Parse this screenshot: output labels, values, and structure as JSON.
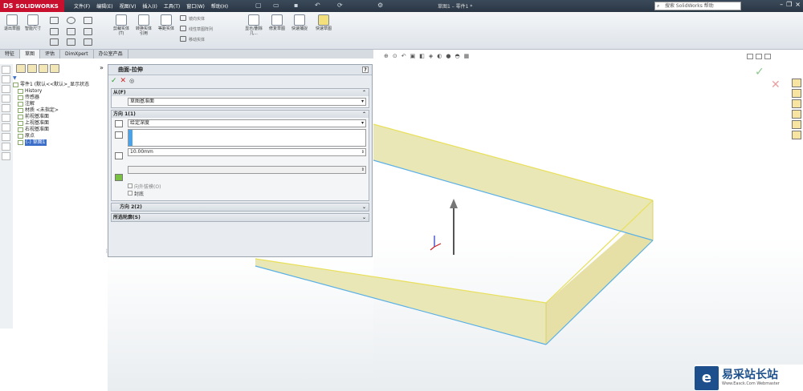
{
  "app": {
    "brand_prefix": "DS",
    "brand": "SOLIDWORKS",
    "window_title": "草图1 – 零件1 *"
  },
  "menu": [
    "文件(F)",
    "编辑(E)",
    "视图(V)",
    "插入(I)",
    "工具(T)",
    "窗口(W)",
    "帮助(H)"
  ],
  "search": {
    "placeholder": "搜索 SolidWorks 帮助"
  },
  "commands": [
    {
      "label": "退出草图"
    },
    {
      "label": "智能尺寸"
    },
    {
      "label": "剪裁实体(T)"
    },
    {
      "label": "转换实体引用"
    },
    {
      "label": "等距实体"
    },
    {
      "label": "显示/删除几..."
    },
    {
      "label": "修复草图"
    },
    {
      "label": "快速捕捉"
    },
    {
      "label": "快速草图"
    }
  ],
  "sketch_tools": [
    "镜向实体",
    "线性草图阵列",
    "移动实体"
  ],
  "tabs": [
    "特征",
    "草图",
    "评估",
    "DimXpert",
    "办公室产品"
  ],
  "tree": {
    "root": "零件1 (默认<<默认>_显示状态",
    "items": [
      "History",
      "传感器",
      "注解",
      "材质 <未指定>",
      "前视基准面",
      "上视基准面",
      "右视基准面",
      "原点",
      "(-) 草图1"
    ]
  },
  "property": {
    "title": "曲面-拉伸",
    "help": "?",
    "from_label": "从(F)",
    "from_value": "草图基准面",
    "dir1_label": "方向 1(1)",
    "end_condition": "给定深度",
    "depth": "10.00mm",
    "draft_label": "向外拔模(O)",
    "cap_label": "封底",
    "dir2_label": "方向 2(2)",
    "contours_label": "所选轮廓(S)"
  },
  "watermark": {
    "main": "易采站长站",
    "sub": "Www.Easck.Com Webmaster"
  },
  "colors": {
    "accent": "#c8102e",
    "face": "#eae7b6",
    "edge_yellow": "#e8e05a",
    "edge_blue": "#5ab0e6"
  }
}
